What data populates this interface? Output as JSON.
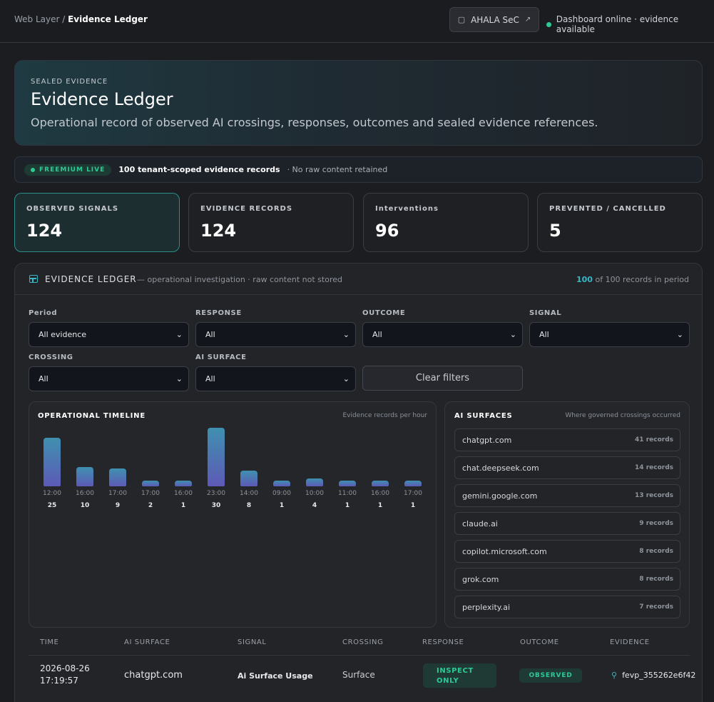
{
  "breadcrumb": {
    "parent": "Web Layer",
    "separator": " / ",
    "current": "Evidence Ledger"
  },
  "tenant_button": {
    "label": "AHALA SeC",
    "icon": "building-icon",
    "external": "↗"
  },
  "status": {
    "text": "Dashboard online · evidence available",
    "color": "#2ec995"
  },
  "hero": {
    "kicker": "SEALED EVIDENCE",
    "title": "Evidence Ledger",
    "description": "Operational record of observed AI crossings, responses, outcomes and sealed evidence references."
  },
  "strip": {
    "badge": "FREEMIUM LIVE",
    "count": "100 tenant-scoped evidence records",
    "note": "· No raw content retained"
  },
  "kpis": [
    {
      "label": "OBSERVED SIGNALS",
      "value": "124"
    },
    {
      "label": "EVIDENCE RECORDS",
      "value": "124"
    },
    {
      "label": "Interventions",
      "value": "96"
    },
    {
      "label": "PREVENTED / CANCELLED",
      "value": "5"
    }
  ],
  "ledger": {
    "title": "EVIDENCE LEDGER",
    "subtitle": "— operational investigation · raw content not stored",
    "records_shown": "100",
    "records_suffix": " of 100 records in period"
  },
  "filters": {
    "period": {
      "label": "Period",
      "value": "All evidence"
    },
    "response": {
      "label": "RESPONSE",
      "value": "All"
    },
    "outcome": {
      "label": "OUTCOME",
      "value": "All"
    },
    "signal": {
      "label": "SIGNAL",
      "value": "All"
    },
    "crossing": {
      "label": "CROSSING",
      "value": "All"
    },
    "surface": {
      "label": "AI SURFACE",
      "value": "All"
    },
    "clear_label": "Clear filters"
  },
  "timeline": {
    "title": "OPERATIONAL TIMELINE",
    "subtitle": "Evidence records per hour"
  },
  "chart_data": {
    "type": "bar",
    "categories": [
      "12:00",
      "16:00",
      "17:00",
      "17:00",
      "16:00",
      "23:00",
      "14:00",
      "09:00",
      "10:00",
      "11:00",
      "16:00",
      "17:00"
    ],
    "values": [
      25,
      10,
      9,
      2,
      1,
      30,
      8,
      1,
      4,
      1,
      1,
      1
    ],
    "title": "OPERATIONAL TIMELINE",
    "subtitle": "Evidence records per hour"
  },
  "surfaces": {
    "title": "AI SURFACES",
    "subtitle": "Where governed crossings occurred",
    "items": [
      {
        "name": "chatgpt.com",
        "records": "41 records"
      },
      {
        "name": "chat.deepseek.com",
        "records": "14 records"
      },
      {
        "name": "gemini.google.com",
        "records": "13 records"
      },
      {
        "name": "claude.ai",
        "records": "9 records"
      },
      {
        "name": "copilot.microsoft.com",
        "records": "8 records"
      },
      {
        "name": "grok.com",
        "records": "8 records"
      },
      {
        "name": "perplexity.ai",
        "records": "7 records"
      }
    ]
  },
  "table": {
    "headers": [
      "TIME",
      "AI SURFACE",
      "SIGNAL",
      "CROSSING",
      "RESPONSE",
      "OUTCOME",
      "EVIDENCE"
    ],
    "rows": [
      {
        "date": "2026-08-26",
        "time": "17:19:57",
        "surface": "chatgpt.com",
        "signal": "Ai Surface Usage",
        "crossing": "Surface",
        "response_line1": "INSPECT",
        "response_line2": "ONLY",
        "outcome": "OBSERVED",
        "evidence": "fevp_355262e6f42"
      }
    ]
  }
}
